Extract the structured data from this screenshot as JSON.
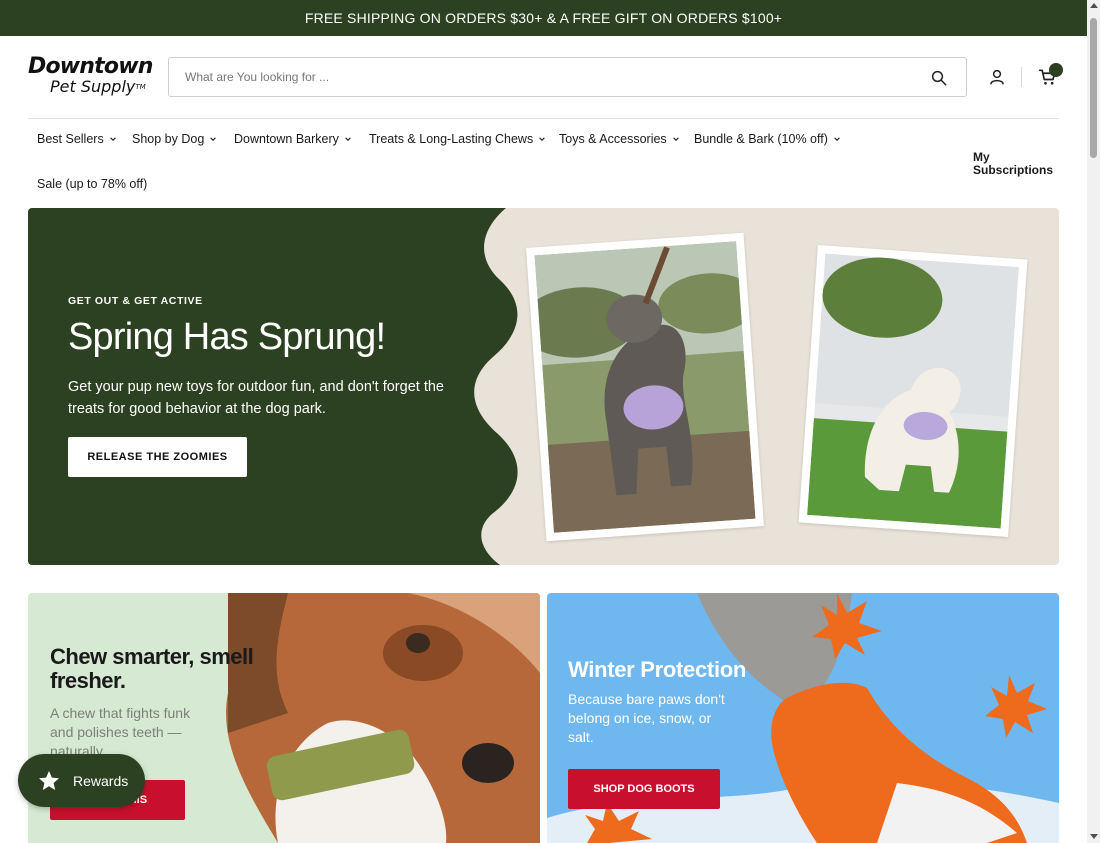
{
  "announcement": {
    "text": "FREE SHIPPING ON ORDERS $30+ & A FREE GIFT ON ORDERS $100+"
  },
  "header": {
    "logo_line1": "Downtown",
    "logo_line2": "Pet Supply",
    "logo_tm": "TM",
    "search_placeholder": "What are You looking for ..."
  },
  "nav": {
    "items": [
      {
        "label": "Best Sellers"
      },
      {
        "label": "Shop by Dog"
      },
      {
        "label": "Downtown Barkery"
      },
      {
        "label": "Treats & Long-Lasting Chews"
      },
      {
        "label": "Toys & Accessories"
      },
      {
        "label": "Bundle & Bark (10% off)"
      },
      {
        "label": "Sale (up to 78% off)"
      }
    ],
    "subscriptions_label": "My Subscriptions"
  },
  "hero": {
    "eyebrow": "GET OUT & GET ACTIVE",
    "title": "Spring Has Sprung!",
    "text": "Get your pup new toys for outdoor fun, and don't forget the treats for good behavior at the dog park.",
    "button": "RELEASE THE ZOOMIES"
  },
  "promo_left": {
    "title": "Chew smarter, smell fresher.",
    "text": "A chew that fights funk and polishes teeth — naturally.",
    "button": "SHOP THIS"
  },
  "promo_right": {
    "title": "Winter Protection",
    "text": "Because bare paws don't belong on ice, snow, or salt.",
    "button": "SHOP DOG BOOTS"
  },
  "rewards": {
    "label": "Rewards"
  },
  "colors": {
    "brand_green": "#2c4121",
    "cta_red": "#c8102e",
    "hero_beige": "#e8e2d8",
    "promo_mint": "#d6e9d3",
    "promo_blue": "#6fb8ef"
  },
  "icons": [
    "search-icon",
    "account-icon",
    "cart-icon",
    "chevron-down-icon",
    "star-icon"
  ]
}
